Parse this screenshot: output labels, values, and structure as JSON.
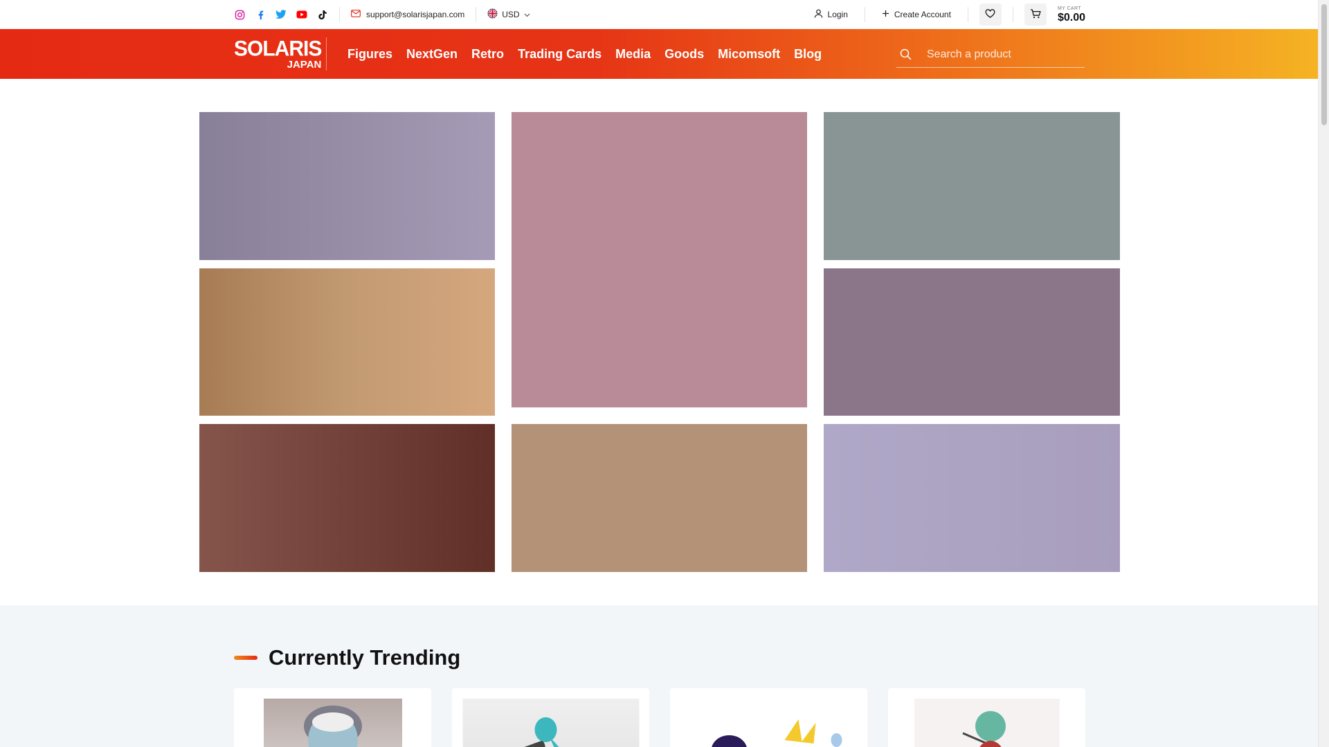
{
  "topbar": {
    "social": [
      "instagram-icon",
      "facebook-icon",
      "twitter-icon",
      "youtube-icon",
      "tiktok-icon"
    ],
    "email": "support@solarisjapan.com",
    "currency": "USD",
    "login": "Login",
    "create_account": "Create Account",
    "cart_label": "MY CART",
    "cart_total": "$0.00"
  },
  "brand": {
    "line1": "SOLARIS",
    "line2": "JAPAN"
  },
  "nav": {
    "items": [
      "Figures",
      "NextGen",
      "Retro",
      "Trading Cards",
      "Media",
      "Goods",
      "Micomsoft",
      "Blog"
    ]
  },
  "search": {
    "placeholder": "Search a product"
  },
  "trending": {
    "title": "Currently Trending"
  },
  "colors": {
    "brand_red": "#e52a13",
    "brand_orange": "#f5b323"
  }
}
